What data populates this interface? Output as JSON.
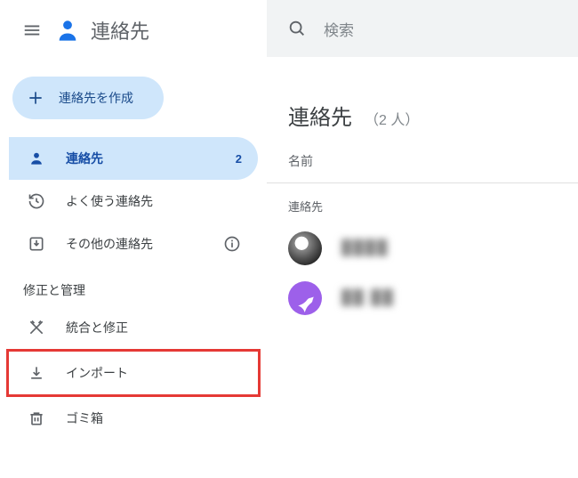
{
  "appTitle": "連絡先",
  "createLabel": "連絡先を作成",
  "nav": {
    "contacts": "連絡先",
    "contactsBadge": "2",
    "frequent": "よく使う連絡先",
    "other": "その他の連絡先"
  },
  "sectionLabel": "修正と管理",
  "tools": {
    "merge": "統合と修正",
    "import": "インポート",
    "trash": "ゴミ箱"
  },
  "search": {
    "placeholder": "検索"
  },
  "main": {
    "title": "連絡先",
    "count": "（2 人）",
    "columnName": "名前",
    "groupLabel": "連絡先",
    "row1": "████",
    "row2": "██ ██"
  }
}
